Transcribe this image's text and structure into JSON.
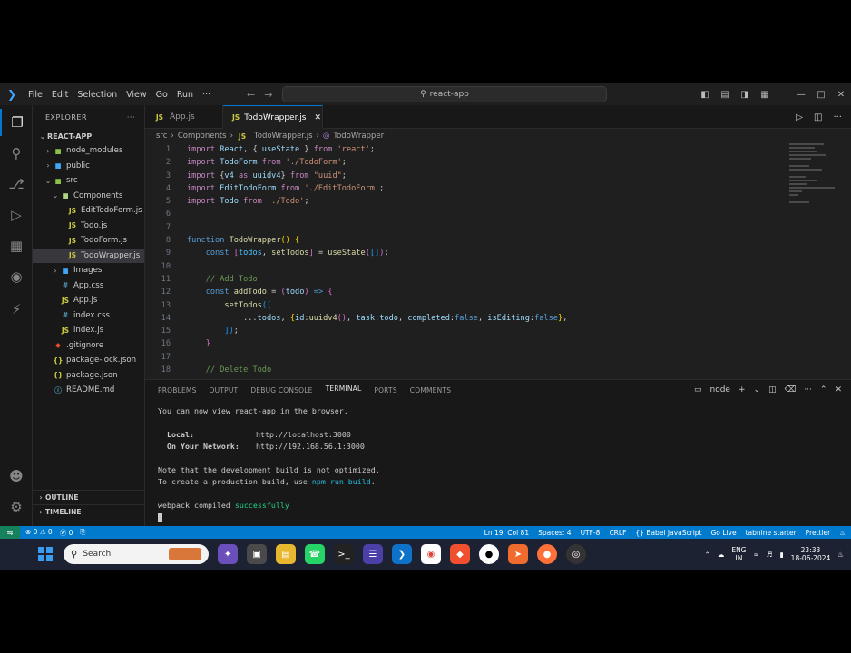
{
  "titlebar": {
    "menu": [
      "File",
      "Edit",
      "Selection",
      "View",
      "Go",
      "Run",
      "···"
    ],
    "search": "react-app"
  },
  "explorer": {
    "title": "EXPLORER",
    "root": "REACT-APP",
    "items": [
      {
        "label": "node_modules",
        "depth": 1,
        "kind": "folder",
        "open": false
      },
      {
        "label": "public",
        "depth": 1,
        "kind": "folder",
        "open": false
      },
      {
        "label": "src",
        "depth": 1,
        "kind": "folder",
        "open": true
      },
      {
        "label": "Components",
        "depth": 2,
        "kind": "folder",
        "open": true
      },
      {
        "label": "EditTodoForm.js",
        "depth": 3,
        "kind": "js"
      },
      {
        "label": "Todo.js",
        "depth": 3,
        "kind": "js"
      },
      {
        "label": "TodoForm.js",
        "depth": 3,
        "kind": "js"
      },
      {
        "label": "TodoWrapper.js",
        "depth": 3,
        "kind": "js",
        "selected": true
      },
      {
        "label": "Images",
        "depth": 2,
        "kind": "folder",
        "open": false
      },
      {
        "label": "App.css",
        "depth": 2,
        "kind": "css"
      },
      {
        "label": "App.js",
        "depth": 2,
        "kind": "js"
      },
      {
        "label": "index.css",
        "depth": 2,
        "kind": "css"
      },
      {
        "label": "index.js",
        "depth": 2,
        "kind": "js"
      },
      {
        "label": ".gitignore",
        "depth": 1,
        "kind": "git"
      },
      {
        "label": "package-lock.json",
        "depth": 1,
        "kind": "json"
      },
      {
        "label": "package.json",
        "depth": 1,
        "kind": "json"
      },
      {
        "label": "README.md",
        "depth": 1,
        "kind": "md"
      }
    ],
    "outline": "OUTLINE",
    "timeline": "TIMELINE"
  },
  "tabs": [
    {
      "label": "App.js",
      "active": false
    },
    {
      "label": "TodoWrapper.js",
      "active": true
    }
  ],
  "breadcrumb": [
    "src",
    "Components",
    "TodoWrapper.js",
    "TodoWrapper"
  ],
  "code": [
    {
      "n": "1",
      "tokens": [
        [
          "kw",
          "import "
        ],
        [
          "vr",
          "React"
        ],
        [
          "",
          ""
        ],
        [
          "",
          ", { "
        ],
        [
          "vr",
          "useState"
        ],
        [
          "",
          " } "
        ],
        [
          "kw",
          "from "
        ],
        [
          "st",
          "'react'"
        ],
        [
          "",
          ";"
        ]
      ]
    },
    {
      "n": "2",
      "tokens": [
        [
          "kw",
          "import "
        ],
        [
          "vr",
          "TodoForm "
        ],
        [
          "kw",
          "from "
        ],
        [
          "st",
          "'./TodoForm'"
        ],
        [
          "",
          ";"
        ]
      ]
    },
    {
      "n": "3",
      "tokens": [
        [
          "kw",
          "import "
        ],
        [
          "",
          "{"
        ],
        [
          "vr",
          "v4 "
        ],
        [
          "kw",
          "as "
        ],
        [
          "vr",
          "uuidv4"
        ],
        [
          "",
          "} "
        ],
        [
          "kw",
          "from "
        ],
        [
          "st",
          "\"uuid\""
        ],
        [
          "",
          ";"
        ]
      ]
    },
    {
      "n": "4",
      "tokens": [
        [
          "kw",
          "import "
        ],
        [
          "vr",
          "EditTodoForm "
        ],
        [
          "kw",
          "from "
        ],
        [
          "st",
          "'./EditTodoForm'"
        ],
        [
          "",
          ";"
        ]
      ]
    },
    {
      "n": "5",
      "tokens": [
        [
          "kw",
          "import "
        ],
        [
          "vr",
          "Todo "
        ],
        [
          "kw",
          "from "
        ],
        [
          "st",
          "'./Todo'"
        ],
        [
          "",
          ";"
        ]
      ]
    },
    {
      "n": "6",
      "tokens": []
    },
    {
      "n": "7",
      "tokens": []
    },
    {
      "n": "8",
      "tokens": [
        [
          "kwb",
          "function "
        ],
        [
          "fn",
          "TodoWrapper"
        ],
        [
          "br1",
          "()"
        ],
        [
          "",
          " "
        ],
        [
          "br1",
          "{"
        ]
      ]
    },
    {
      "n": "9",
      "tokens": [
        [
          "",
          "    "
        ],
        [
          "kwb",
          "const "
        ],
        [
          "br2",
          "["
        ],
        [
          "cn",
          "todos"
        ],
        [
          "",
          ", "
        ],
        [
          "fn",
          "setTodos"
        ],
        [
          "br2",
          "]"
        ],
        [
          "",
          " = "
        ],
        [
          "fn",
          "useState"
        ],
        [
          "br2",
          "("
        ],
        [
          "br3",
          "[]"
        ],
        [
          "br2",
          ")"
        ],
        [
          "",
          ";"
        ]
      ]
    },
    {
      "n": "10",
      "tokens": []
    },
    {
      "n": "11",
      "tokens": [
        [
          "",
          "    "
        ],
        [
          "cm",
          "// Add Todo"
        ]
      ]
    },
    {
      "n": "12",
      "tokens": [
        [
          "",
          "    "
        ],
        [
          "kwb",
          "const "
        ],
        [
          "fn",
          "addTodo "
        ],
        [
          "",
          "= "
        ],
        [
          "br2",
          "("
        ],
        [
          "vr",
          "todo"
        ],
        [
          "br2",
          ")"
        ],
        [
          "",
          " "
        ],
        [
          "kwb",
          "=> "
        ],
        [
          "br2",
          "{"
        ]
      ]
    },
    {
      "n": "13",
      "tokens": [
        [
          "",
          "        "
        ],
        [
          "fn",
          "setTodos"
        ],
        [
          "br3",
          "(["
        ]
      ]
    },
    {
      "n": "14",
      "tokens": [
        [
          "",
          "            ..."
        ],
        [
          "vr",
          "todos"
        ],
        [
          "",
          ", "
        ],
        [
          "br1",
          "{"
        ],
        [
          "vr",
          "id"
        ],
        [
          "",
          ":"
        ],
        [
          "fn",
          "uuidv4"
        ],
        [
          "br2",
          "()"
        ],
        [
          "",
          ", "
        ],
        [
          "vr",
          "task"
        ],
        [
          "",
          ":"
        ],
        [
          "vr",
          "todo"
        ],
        [
          "",
          ", "
        ],
        [
          "vr",
          "completed"
        ],
        [
          "",
          ":"
        ],
        [
          "kwb",
          "false"
        ],
        [
          "",
          ", "
        ],
        [
          "vr",
          "isEditing"
        ],
        [
          "",
          ":"
        ],
        [
          "kwb",
          "false"
        ],
        [
          "br1",
          "}"
        ],
        [
          "",
          ","
        ]
      ]
    },
    {
      "n": "15",
      "tokens": [
        [
          "",
          "        "
        ],
        [
          "br3",
          "])"
        ],
        [
          "",
          ";"
        ]
      ]
    },
    {
      "n": "16",
      "tokens": [
        [
          "",
          "    "
        ],
        [
          "br2",
          "}"
        ]
      ]
    },
    {
      "n": "17",
      "tokens": []
    },
    {
      "n": "18",
      "tokens": [
        [
          "",
          "    "
        ],
        [
          "cm",
          "// Delete Todo"
        ]
      ]
    }
  ],
  "panel": {
    "tabs": [
      "PROBLEMS",
      "OUTPUT",
      "DEBUG CONSOLE",
      "TERMINAL",
      "PORTS",
      "COMMENTS"
    ],
    "active": "TERMINAL",
    "shell": "node"
  },
  "terminal": {
    "l1": "You can now view react-app in the browser.",
    "local_label": "  Local:",
    "local_url": "http://localhost:3000",
    "net_label": "  On Your Network:",
    "net_url": "http://192.168.56.1:3000",
    "l4": "Note that the development build is not optimized.",
    "l5a": "To create a production build, use ",
    "l5b": "npm run build",
    "l5c": ".",
    "l6a": "webpack compiled ",
    "l6b": "successfully"
  },
  "status": {
    "left": [
      "⊗ 0 ⚠ 0",
      "ⓦ 0",
      "⎘"
    ],
    "right": [
      "Ln 19, Col 81",
      "Spaces: 4",
      "UTF-8",
      "CRLF",
      "{} Babel JavaScript",
      "Go Live",
      "tabnine starter",
      "Prettier"
    ]
  },
  "taskbar": {
    "search": "Search",
    "lang1": "ENG",
    "lang2": "IN",
    "time": "23:33",
    "date": "18-06-2024"
  },
  "colors": {
    "accent": "#0078d4",
    "statusbar": "#007acc",
    "editor_bg": "#1f1f1f",
    "sidebar_bg": "#181818"
  }
}
